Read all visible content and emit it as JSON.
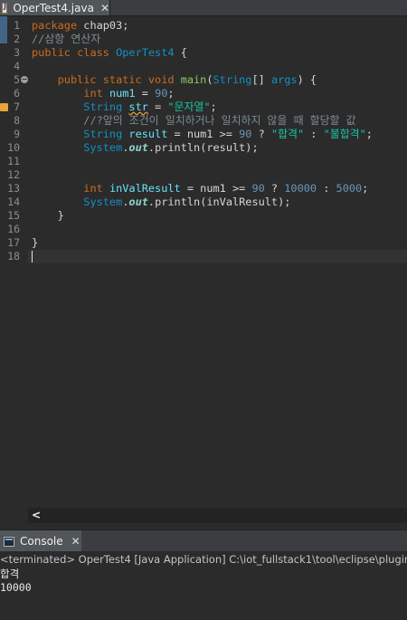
{
  "editor_tab": {
    "label": "OperTest4.java",
    "icon": "java-file-icon",
    "close_glyph": "✕"
  },
  "line_numbers": [
    "1",
    "2",
    "3",
    "4",
    "5",
    "6",
    "7",
    "8",
    "9",
    "10",
    "11",
    "12",
    "13",
    "14",
    "15",
    "16",
    "17",
    "18"
  ],
  "code": {
    "l1": {
      "kw": "package",
      "rest": " chap03;"
    },
    "l2": {
      "comment": "//삼항 연산자"
    },
    "l3": {
      "kw1": "public",
      "kw2": "class",
      "name": "OperTest4",
      "rest": " {"
    },
    "l5": {
      "kw1": "public",
      "kw2": "static",
      "kw3": "void",
      "method": "main",
      "p1": "(",
      "type": "String",
      "p2": "[] ",
      "arg": "args",
      "p3": ") {"
    },
    "l6": {
      "type": "int",
      "var": "num1",
      "op": " = ",
      "num": "90",
      "end": ";"
    },
    "l7": {
      "type": "String",
      "var": "str",
      "op": " = ",
      "str": "\"문자열\"",
      "end": ";"
    },
    "l8": {
      "comment": "//?앞의 조건이 일치하거나 일치하지 않을 때 할당할 값"
    },
    "l9": {
      "type": "String",
      "var": "result",
      "op1": " = num1 >= ",
      "num": "90",
      "op2": " ? ",
      "s1": "\"합격\"",
      "op3": " : ",
      "s2": "\"불합격\"",
      "end": ";"
    },
    "l10": {
      "cls": "System",
      "dot1": ".",
      "field": "out",
      "dot2": ".",
      "call": "println",
      "args": "(result);"
    },
    "l13": {
      "type": "int",
      "var": "inValResult",
      "op1": " = num1 >= ",
      "num1": "90",
      "op2": " ? ",
      "num2": "10000",
      "op3": " : ",
      "num3": "5000",
      "end": ";"
    },
    "l14": {
      "cls": "System",
      "dot1": ".",
      "field": "out",
      "dot2": ".",
      "call": "println",
      "args": "(inValResult);"
    },
    "l15": {
      "text": "}"
    },
    "l17": {
      "text": "}"
    }
  },
  "scrollbar": {
    "left_arrow": "<"
  },
  "console": {
    "tab_label": "Console",
    "close_glyph": "✕",
    "header": "<terminated> OperTest4 [Java Application] C:\\iot_fullstack1\\tool\\eclipse\\plugins\\",
    "output": [
      "합격",
      "10000"
    ]
  }
}
